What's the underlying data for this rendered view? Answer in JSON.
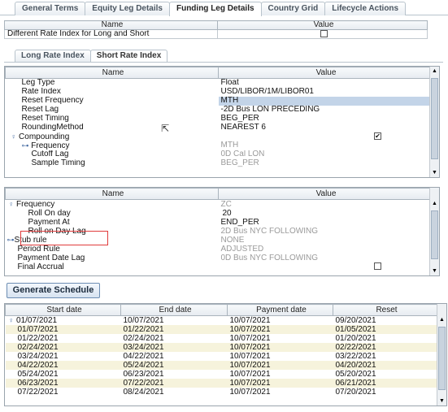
{
  "tabs": [
    "General Terms",
    "Equity Leg Details",
    "Funding Leg Details",
    "Country Grid",
    "Lifecycle Actions"
  ],
  "top_table": {
    "headers": [
      "Name",
      "Value"
    ],
    "row_label": "Different Rate Index for Long and Short",
    "row_checked": false
  },
  "subtabs": [
    "Long Rate Index",
    "Short Rate Index"
  ],
  "props1": {
    "headers": [
      "Name",
      "Value"
    ],
    "rows": [
      {
        "name": "Leg Type",
        "value": "Float"
      },
      {
        "name": "Rate Index",
        "value": "USD/LIBOR/1M/LIBOR01"
      },
      {
        "name": "Reset Frequency",
        "value": "MTH"
      },
      {
        "name": "Reset Lag",
        "value": "-2D Bus LON PRECEDING"
      },
      {
        "name": "Reset Timing",
        "value": "BEG_PER"
      },
      {
        "name": "RoundingMethod",
        "value": "NEAREST 6"
      },
      {
        "name": "Compounding",
        "value": ""
      },
      {
        "name": "Frequency",
        "value": "MTH"
      },
      {
        "name": "Cutoff Lag",
        "value": "0D Cal LON"
      },
      {
        "name": "Sample Timing",
        "value": "BEG_PER"
      }
    ]
  },
  "props2": {
    "headers": [
      "Name",
      "Value"
    ],
    "rows": [
      {
        "name": "Frequency",
        "value": "ZC"
      },
      {
        "name": "Roll On day",
        "value": "20"
      },
      {
        "name": "Payment At",
        "value": "END_PER"
      },
      {
        "name": "Roll on Day Lag",
        "value": "2D Bus NYC FOLLOWING"
      },
      {
        "name": "Stub rule",
        "value": "NONE"
      },
      {
        "name": "Period Rule",
        "value": "ADJUSTED"
      },
      {
        "name": "Payment Date Lag",
        "value": "0D Bus NYC FOLLOWING"
      },
      {
        "name": "Final Accrual",
        "value": ""
      }
    ]
  },
  "generate_button": "Generate Schedule",
  "schedule": {
    "headers": [
      "Start date",
      "End date",
      "Payment date",
      "Reset"
    ],
    "rows": [
      [
        "01/07/2021",
        "10/07/2021",
        "10/07/2021",
        "09/20/2021"
      ],
      [
        "01/07/2021",
        "01/22/2021",
        "10/07/2021",
        "01/05/2021"
      ],
      [
        "01/22/2021",
        "02/24/2021",
        "10/07/2021",
        "01/20/2021"
      ],
      [
        "02/24/2021",
        "03/24/2021",
        "10/07/2021",
        "02/22/2021"
      ],
      [
        "03/24/2021",
        "04/22/2021",
        "10/07/2021",
        "03/22/2021"
      ],
      [
        "04/22/2021",
        "05/24/2021",
        "10/07/2021",
        "04/20/2021"
      ],
      [
        "05/24/2021",
        "06/23/2021",
        "10/07/2021",
        "05/20/2021"
      ],
      [
        "06/23/2021",
        "07/22/2021",
        "10/07/2021",
        "06/21/2021"
      ],
      [
        "07/22/2021",
        "08/24/2021",
        "10/07/2021",
        "07/20/2021"
      ]
    ]
  }
}
